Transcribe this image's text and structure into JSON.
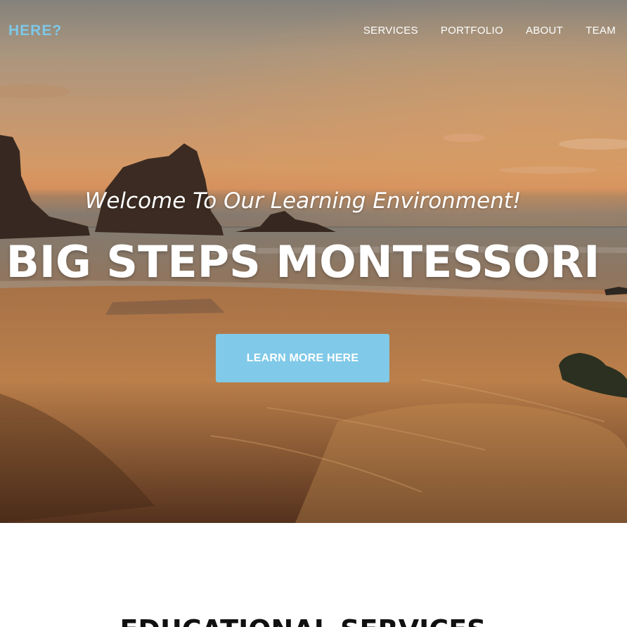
{
  "brand": "HERE?",
  "nav": {
    "items": [
      "SERVICES",
      "PORTFOLIO",
      "ABOUT",
      "TEAM"
    ]
  },
  "hero": {
    "subtitle": "Welcome To Our Learning Environment!",
    "title": "BIG STEPS MONTESSORI",
    "cta_label": "LEARN MORE HERE",
    "background": "sunset beach with sea stacks"
  },
  "services": {
    "heading": "EDUCATIONAL SERVICES"
  },
  "colors": {
    "accent": "#80c9e8",
    "brand": "#7ec8e8",
    "heading": "#111111"
  }
}
